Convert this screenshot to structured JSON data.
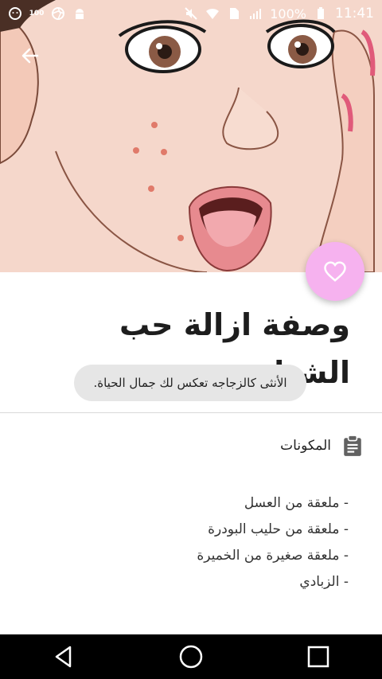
{
  "status_bar": {
    "battery": "100%",
    "time": "11:41",
    "notification_badge": "100"
  },
  "recipe": {
    "title": "وصفة ازالة حب الشباب",
    "quote": "الأنثى كالزجاجه تعكس لك جمال الحياة."
  },
  "ingredients_section": {
    "title": "المكونات",
    "items": [
      "- ملعقة من العسل",
      "- ملعقة من حليب البودرة",
      "- ملعقة صغيرة من الخميرة",
      "- الزبادي"
    ]
  },
  "colors": {
    "fab": "#f6b2ef",
    "chip_bg": "#e6e6e6",
    "nav_bar": "#000000"
  }
}
